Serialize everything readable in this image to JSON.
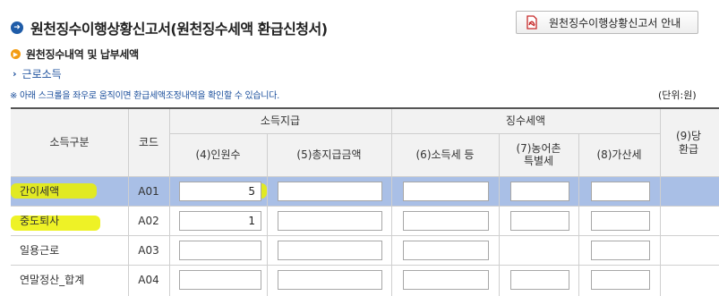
{
  "page": {
    "title": "원천징수이행상황신고서(원천징수세액 환급신청서)",
    "guide_button": "원천징수이행상황신고서 안내",
    "section_title": "원천징수내역 및 납부세액",
    "subsection": "근로소득",
    "note": "※ 아래 스크롤을 좌우로 움직이면 환급세액조정내역을 확인할 수 있습니다.",
    "unit": "(단위:원)"
  },
  "icons": {
    "title": "circle-arrow-icon",
    "section": "orange-circle-icon",
    "guide": "pdf-icon",
    "sub": "chevron-right-icon"
  },
  "colors": {
    "accent": "#1f5ca8",
    "highlight_row": "#a9bfe6",
    "marker": "#ebf000"
  },
  "table": {
    "headers": {
      "income_type": "소득구분",
      "code": "코드",
      "income_payment": "소득지급",
      "withholding_tax": "징수세액",
      "headcount": "(4)인원수",
      "total_payment": "(5)총지급금액",
      "income_tax": "(6)소득세 등",
      "rural_tax": "(7)농어촌\n특별세",
      "additional_tax": "(8)가산세",
      "refund": "(9)당\n환급"
    },
    "rows": [
      {
        "label": "간이세액",
        "code": "A01",
        "headcount": "5",
        "total_payment": "",
        "income_tax": "",
        "rural_tax": "",
        "additional_tax": ""
      },
      {
        "label": "중도퇴사",
        "code": "A02",
        "headcount": "1",
        "total_payment": "",
        "income_tax": "",
        "rural_tax": "",
        "additional_tax": ""
      },
      {
        "label": "일용근로",
        "code": "A03",
        "headcount": "",
        "total_payment": "",
        "income_tax": "",
        "rural_tax": "",
        "additional_tax": ""
      },
      {
        "label": "연말정산_합계",
        "code": "A04",
        "headcount": "",
        "total_payment": "",
        "income_tax": "",
        "rural_tax": "",
        "additional_tax": ""
      }
    ]
  }
}
